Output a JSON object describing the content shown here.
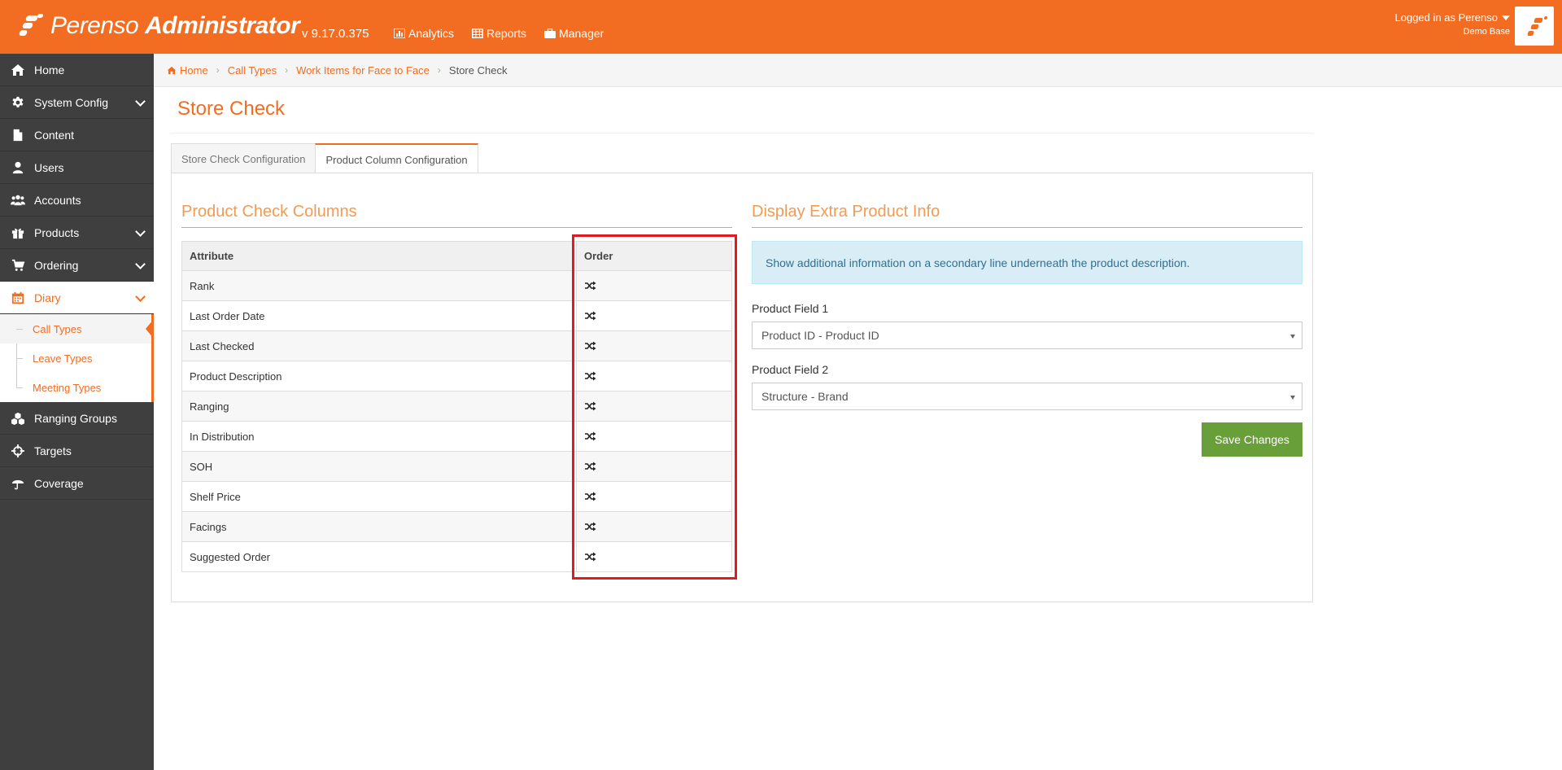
{
  "app": {
    "brand_light": "Perenso",
    "brand_bold": "Administrator",
    "version": "v 9.17.0.375"
  },
  "topnav": [
    {
      "label": "Analytics",
      "icon": "bar-chart-icon"
    },
    {
      "label": "Reports",
      "icon": "table-icon"
    },
    {
      "label": "Manager",
      "icon": "briefcase-icon"
    }
  ],
  "user": {
    "logged_in": "Logged in as Perenso",
    "base": "Demo Base"
  },
  "sidebar": {
    "items": [
      {
        "label": "Home",
        "icon": "home-icon"
      },
      {
        "label": "System Config",
        "icon": "gear-icon"
      },
      {
        "label": "Content",
        "icon": "file-icon"
      },
      {
        "label": "Users",
        "icon": "user-icon"
      },
      {
        "label": "Accounts",
        "icon": "users-icon"
      },
      {
        "label": "Products",
        "icon": "gift-icon"
      },
      {
        "label": "Ordering",
        "icon": "cart-icon"
      },
      {
        "label": "Diary",
        "icon": "calendar-icon"
      },
      {
        "label": "Ranging Groups",
        "icon": "cubes-icon"
      },
      {
        "label": "Targets",
        "icon": "crosshairs-icon"
      },
      {
        "label": "Coverage",
        "icon": "umbrella-icon"
      }
    ],
    "diary_sub": [
      "Call Types",
      "Leave Types",
      "Meeting Types"
    ]
  },
  "breadcrumb": {
    "home": "Home",
    "call_types": "Call Types",
    "work_items": "Work Items for Face to Face",
    "current": "Store Check"
  },
  "page": {
    "title": "Store Check",
    "tabs": [
      "Store Check Configuration",
      "Product Column Configuration"
    ]
  },
  "columns": {
    "heading": "Product Check Columns",
    "header_attribute": "Attribute",
    "header_order": "Order",
    "rows": [
      "Rank",
      "Last Order Date",
      "Last Checked",
      "Product Description",
      "Ranging",
      "In Distribution",
      "SOH",
      "Shelf Price",
      "Facings",
      "Suggested Order"
    ]
  },
  "extra": {
    "heading": "Display Extra Product Info",
    "info": "Show additional information on a secondary line underneath the product description.",
    "field1_label": "Product Field 1",
    "field1_value": "Product ID - Product ID",
    "field2_label": "Product Field 2",
    "field2_value": "Structure - Brand",
    "save_label": "Save Changes"
  },
  "colors": {
    "brand": "#f26d21",
    "sidebar": "#3f3f3f",
    "save": "#689f38",
    "highlight": "#e21b23"
  }
}
